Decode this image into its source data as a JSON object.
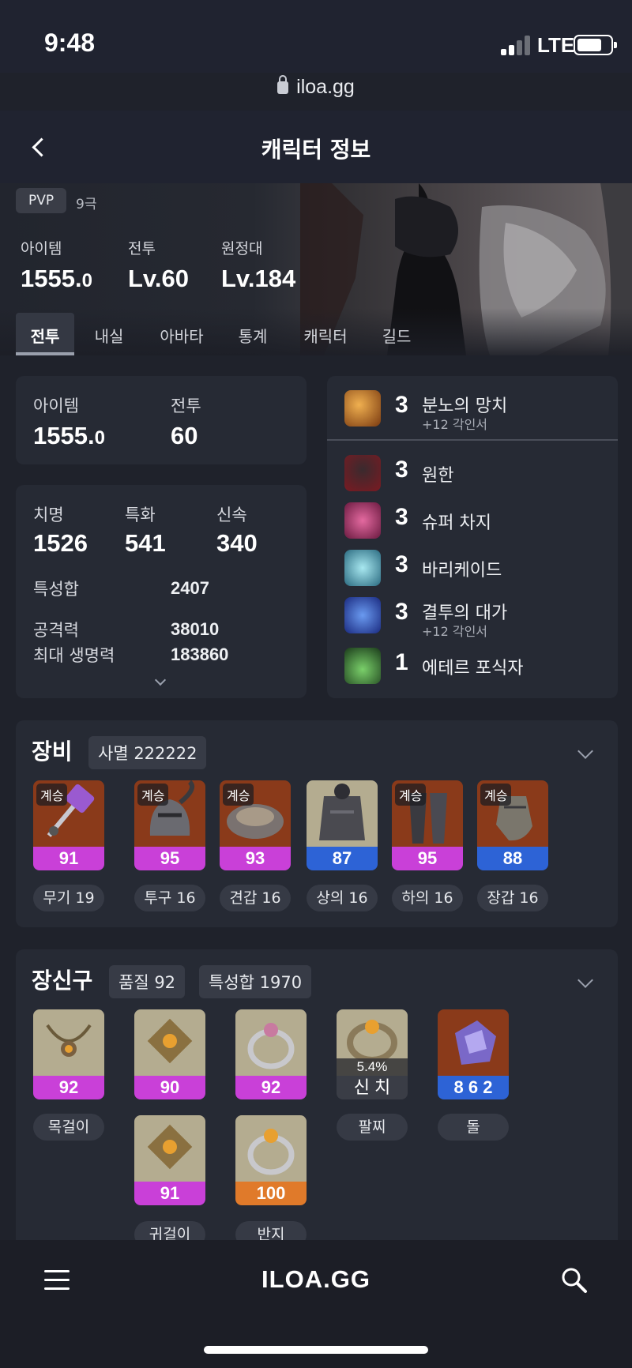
{
  "status": {
    "time": "9:48",
    "network": "LTE"
  },
  "browser": {
    "url": "iloa.gg"
  },
  "header": {
    "title": "캐릭터 정보"
  },
  "banner": {
    "pvp_badge": "PVP",
    "rank": "9극",
    "stats": [
      {
        "label": "아이템",
        "value": "1555.",
        "decimal": "0"
      },
      {
        "label": "전투",
        "value": "Lv.60"
      },
      {
        "label": "원정대",
        "value": "Lv.184"
      }
    ]
  },
  "tabs": [
    "전투",
    "내실",
    "아바타",
    "통계",
    "캐릭터",
    "길드"
  ],
  "level_card": {
    "item_label": "아이템",
    "item_value": "1555.",
    "item_decimal": "0",
    "battle_label": "전투",
    "battle_value": "60"
  },
  "stats_card": {
    "crit_label": "치명",
    "crit_value": "1526",
    "spec_label": "특화",
    "spec_value": "541",
    "swift_label": "신속",
    "swift_value": "340",
    "total_label": "특성합",
    "total_value": "2407",
    "atk_label": "공격력",
    "atk_value": "38010",
    "hp_label": "최대 생명력",
    "hp_value": "183860"
  },
  "engravings": [
    {
      "level": "3",
      "name": "분노의 망치",
      "sub": "+12 각인서",
      "color": "#b8651e"
    },
    {
      "level": "3",
      "name": "원한",
      "sub": "",
      "color": "#7b1a22"
    },
    {
      "level": "3",
      "name": "슈퍼 차지",
      "sub": "",
      "color": "#a0326a"
    },
    {
      "level": "3",
      "name": "바리케이드",
      "sub": "",
      "color": "#3a8fa8"
    },
    {
      "level": "3",
      "name": "결투의 대가",
      "sub": "+12 각인서",
      "color": "#2a4fa8"
    },
    {
      "level": "1",
      "name": "에테르 포식자",
      "sub": "",
      "color": "#2f7a3a"
    }
  ],
  "equipment": {
    "title": "장비",
    "set": "사멸 222222",
    "items": [
      {
        "tag": "계승",
        "quality": "91",
        "label": "무기 19",
        "q_color": "#c940d8"
      },
      {
        "tag": "계승",
        "quality": "95",
        "label": "투구 16",
        "q_color": "#c940d8"
      },
      {
        "tag": "계승",
        "quality": "93",
        "label": "견갑 16",
        "q_color": "#c940d8"
      },
      {
        "tag": "",
        "quality": "87",
        "label": "상의 16",
        "q_color": "#2d63d6"
      },
      {
        "tag": "계승",
        "quality": "95",
        "label": "하의 16",
        "q_color": "#c940d8"
      },
      {
        "tag": "계승",
        "quality": "88",
        "label": "장갑 16",
        "q_color": "#2d63d6"
      }
    ]
  },
  "accessories": {
    "title": "장신구",
    "quality_chip": "품질 92",
    "stat_chip": "특성합 1970",
    "row1": [
      {
        "quality": "92",
        "label": "목걸이",
        "q_color": "#c940d8"
      },
      {
        "quality": "90",
        "label": "",
        "q_color": "#c940d8"
      },
      {
        "quality": "92",
        "label": "",
        "q_color": "#c940d8"
      },
      {
        "quality": "신 치",
        "overlay": "5.4%",
        "label": "팔찌",
        "q_color": "#3a3d46"
      },
      {
        "quality": "8 6 2",
        "label": "돌",
        "q_color": "#2d63d6"
      }
    ],
    "row2": [
      {
        "quality": "91",
        "label": "귀걸이",
        "q_color": "#c940d8"
      },
      {
        "quality": "100",
        "label": "반지",
        "q_color": "#e07a2a"
      }
    ]
  },
  "navbar": {
    "logo": "ILOA.GG"
  }
}
